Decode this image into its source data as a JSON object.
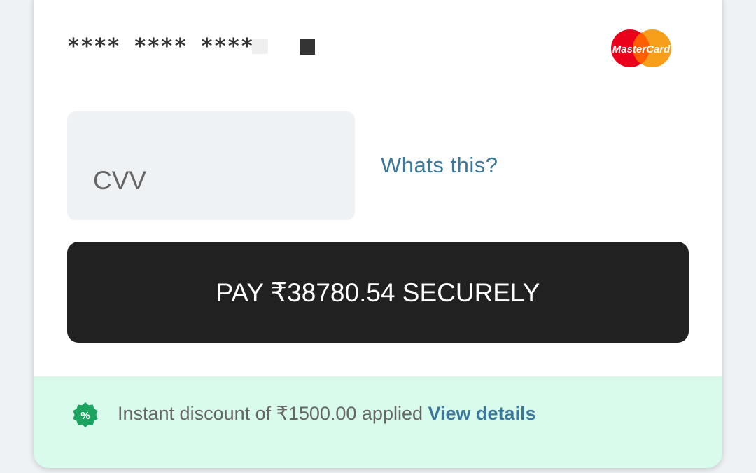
{
  "card": {
    "masked_number": "**** **** ****",
    "brand": "MasterCard",
    "brand_colors": {
      "red": "#eb001b",
      "orange": "#f79e1b"
    }
  },
  "cvv": {
    "placeholder": "CVV",
    "help_link": "Whats this?"
  },
  "pay_button": {
    "label": "PAY ₹38780.54 SECURELY"
  },
  "discount": {
    "icon": "percent-badge-icon",
    "text": "Instant discount of ₹1500.00 applied",
    "link": "View details",
    "accent": "#1aa45f"
  }
}
